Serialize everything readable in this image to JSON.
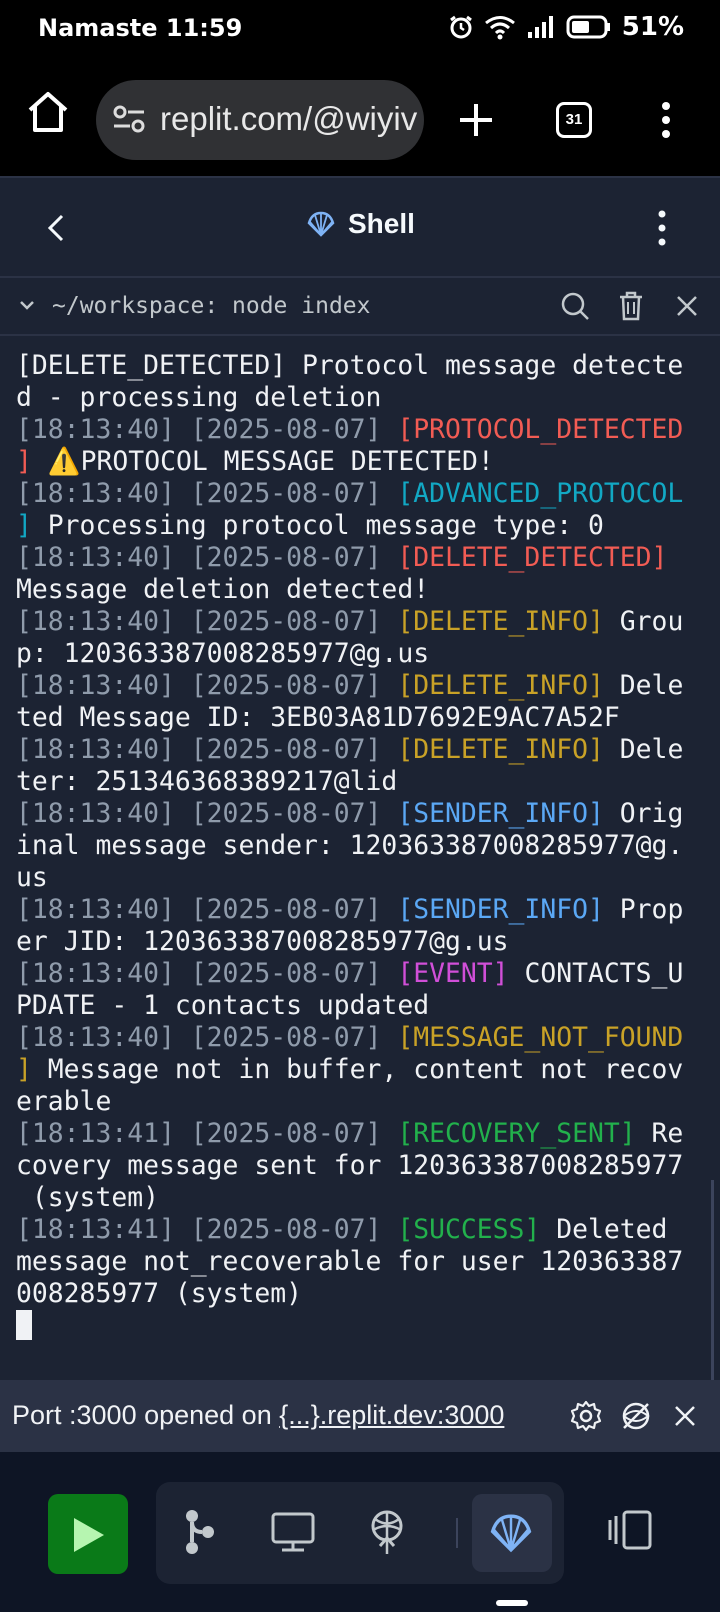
{
  "statusbar": {
    "time": "Namaste 11:59",
    "battery": "51%"
  },
  "browser": {
    "url": "replit.com/@wiyiv",
    "tab_count": "31"
  },
  "header": {
    "title": "Shell"
  },
  "terminal": {
    "path": "~/workspace: node index",
    "lines": [
      [
        {
          "t": "[DELETE_DETECTED] Protocol message detecte",
          "c": ""
        }
      ],
      [
        {
          "t": "d - processing deletion",
          "c": ""
        }
      ],
      [
        {
          "t": "[18:13:40] [2025-08-07] ",
          "c": "gray"
        },
        {
          "t": "[PROTOCOL_DETECTED",
          "c": "red"
        }
      ],
      [
        {
          "t": "]",
          "c": "red"
        },
        {
          "t": " ⚠️PROTOCOL MESSAGE DETECTED!",
          "c": ""
        }
      ],
      [
        {
          "t": "[18:13:40] [2025-08-07] ",
          "c": "gray"
        },
        {
          "t": "[ADVANCED_PROTOCOL",
          "c": "cyan"
        }
      ],
      [
        {
          "t": "]",
          "c": "cyan"
        },
        {
          "t": " Processing protocol message type: 0",
          "c": ""
        }
      ],
      [
        {
          "t": "[18:13:40] [2025-08-07] ",
          "c": "gray"
        },
        {
          "t": "[DELETE_DETECTED]",
          "c": "red"
        }
      ],
      [
        {
          "t": "Message deletion detected!",
          "c": ""
        }
      ],
      [
        {
          "t": "[18:13:40] [2025-08-07] ",
          "c": "gray"
        },
        {
          "t": "[DELETE_INFO]",
          "c": "yellow"
        },
        {
          "t": " Grou",
          "c": ""
        }
      ],
      [
        {
          "t": "p: 120363387008285977@g.us",
          "c": ""
        }
      ],
      [
        {
          "t": "[18:13:40] [2025-08-07] ",
          "c": "gray"
        },
        {
          "t": "[DELETE_INFO]",
          "c": "yellow"
        },
        {
          "t": " Dele",
          "c": ""
        }
      ],
      [
        {
          "t": "ted Message ID: 3EB03A81D7692E9AC7A52F",
          "c": ""
        }
      ],
      [
        {
          "t": "[18:13:40] [2025-08-07] ",
          "c": "gray"
        },
        {
          "t": "[DELETE_INFO]",
          "c": "yellow"
        },
        {
          "t": " Dele",
          "c": ""
        }
      ],
      [
        {
          "t": "ter: 251346368389217@lid",
          "c": ""
        }
      ],
      [
        {
          "t": "[18:13:40] [2025-08-07] ",
          "c": "gray"
        },
        {
          "t": "[SENDER_INFO]",
          "c": "blue"
        },
        {
          "t": " Orig",
          "c": ""
        }
      ],
      [
        {
          "t": "inal message sender: 120363387008285977@g.",
          "c": ""
        }
      ],
      [
        {
          "t": "us",
          "c": ""
        }
      ],
      [
        {
          "t": "[18:13:40] [2025-08-07] ",
          "c": "gray"
        },
        {
          "t": "[SENDER_INFO]",
          "c": "blue"
        },
        {
          "t": " Prop",
          "c": ""
        }
      ],
      [
        {
          "t": "er JID: 120363387008285977@g.us",
          "c": ""
        }
      ],
      [
        {
          "t": "[18:13:40] [2025-08-07] ",
          "c": "gray"
        },
        {
          "t": "[EVENT]",
          "c": "magenta"
        },
        {
          "t": " CONTACTS_U",
          "c": ""
        }
      ],
      [
        {
          "t": "PDATE - 1 contacts updated",
          "c": ""
        }
      ],
      [
        {
          "t": "[18:13:40] [2025-08-07] ",
          "c": "gray"
        },
        {
          "t": "[MESSAGE_NOT_FOUND",
          "c": "yellow"
        }
      ],
      [
        {
          "t": "]",
          "c": "yellow"
        },
        {
          "t": " Message not in buffer, content not recov",
          "c": ""
        }
      ],
      [
        {
          "t": "erable",
          "c": ""
        }
      ],
      [
        {
          "t": "[18:13:41] [2025-08-07] ",
          "c": "gray"
        },
        {
          "t": "[RECOVERY_SENT]",
          "c": "green"
        },
        {
          "t": " Re",
          "c": ""
        }
      ],
      [
        {
          "t": "covery message sent for 120363387008285977",
          "c": ""
        }
      ],
      [
        {
          "t": " (system)",
          "c": ""
        }
      ],
      [
        {
          "t": "[18:13:41] [2025-08-07] ",
          "c": "gray"
        },
        {
          "t": "[SUCCESS]",
          "c": "green"
        },
        {
          "t": " Deleted",
          "c": ""
        }
      ],
      [
        {
          "t": "message not_recoverable for user 120363387",
          "c": ""
        }
      ],
      [
        {
          "t": "008285977 (system)",
          "c": ""
        }
      ]
    ]
  },
  "portbar": {
    "prefix": "Port :3000 opened on ",
    "link": "{...}.replit.dev:3000"
  },
  "icons": {
    "browser": [
      "home-icon",
      "site-settings-icon",
      "plus-icon",
      "tabs-icon",
      "more-vertical-icon"
    ],
    "header": [
      "back-arrow-icon",
      "shell-icon",
      "more-vertical-icon"
    ],
    "terminal_bar": [
      "chevron-down-icon",
      "search-icon",
      "trash-icon",
      "close-icon"
    ],
    "portbar": [
      "gear-icon",
      "preview-off-icon",
      "close-icon"
    ],
    "bottom": [
      "run-icon",
      "git-icon",
      "monitor-icon",
      "deployments-icon",
      "shell-icon",
      "panel-icon"
    ]
  },
  "colors": {
    "background": "#0e1525",
    "surface": "#1c2333",
    "surface_alt": "#2b3245",
    "run_green": "#0a7a18",
    "gray": "#8f9bab",
    "red": "#f25c54",
    "cyan": "#12a8c4",
    "yellow": "#c9a227",
    "blue": "#5ba8f5",
    "magenta": "#d14fd8",
    "green": "#22b14c"
  }
}
